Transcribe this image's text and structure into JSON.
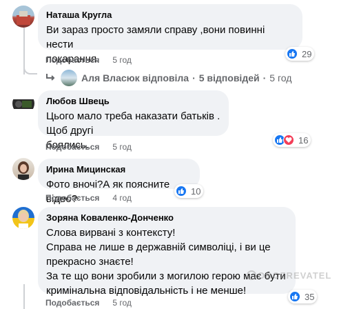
{
  "comments": [
    {
      "author": "Наташа Кругла",
      "text_lines": [
        "Ви зараз просто замяли справу ,вони повинні нести",
        "покарання."
      ],
      "like_label": "Подобається",
      "time": "5 год",
      "reactions_count": "29",
      "reactions": [
        "like-icon"
      ]
    },
    {
      "author": "Любов Швець",
      "text_lines": [
        "Цього мало треба наказати батьків . Щоб другі",
        "боялись."
      ],
      "like_label": "Подобається",
      "time": "5 год",
      "reactions_count": "16",
      "reactions": [
        "like-icon",
        "love-icon"
      ]
    },
    {
      "author": "Ирина Мицинская",
      "text_lines": [
        "Фото вночі?А як поясните відео?"
      ],
      "like_label": "Подобається",
      "time": "4 год",
      "reactions_count": "10",
      "reactions": [
        "like-icon"
      ]
    },
    {
      "author": "Зоряна Коваленко-Донченко",
      "text_lines": [
        "Слова вирвані з контексту!",
        "Справа не лише в державній символіці, і ви це",
        "прекрасно знаєте!",
        "За те що вони зробили з могилою герою має бути",
        "кримінальна відповідальність і не менше!"
      ],
      "like_label": "Подобається",
      "time": "5 год",
      "reactions_count": "35",
      "reactions": [
        "like-icon"
      ]
    }
  ],
  "reply_thread": {
    "author": "Аля Власюк",
    "verb": "відповіла",
    "separator": "·",
    "replies": "5 відповідей",
    "time": "5 год"
  },
  "watermark": "OBOZREVATEL",
  "colors": {
    "bubble": "#f0f2f5",
    "meta": "#65676b",
    "like": "#1877f2",
    "love": "#f33e58"
  }
}
